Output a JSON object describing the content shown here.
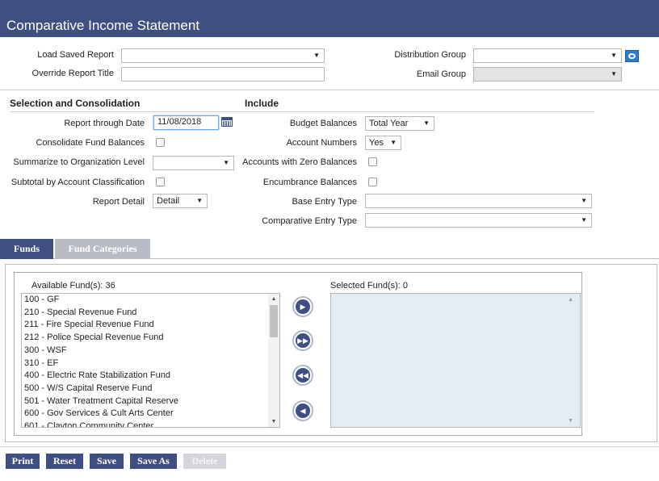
{
  "header": {
    "title": "Comparative Income Statement"
  },
  "top": {
    "load_saved_report_label": "Load Saved Report",
    "load_saved_report_value": "",
    "override_title_label": "Override Report Title",
    "override_title_value": "",
    "distribution_group_label": "Distribution Group",
    "distribution_group_value": "",
    "email_group_label": "Email Group",
    "email_group_value": ""
  },
  "selection": {
    "heading": "Selection and Consolidation",
    "report_through_date_label": "Report through Date",
    "report_through_date_value": "11/08/2018",
    "consolidate_fund_label": "Consolidate Fund Balances",
    "consolidate_fund_checked": false,
    "summarize_org_label": "Summarize to Organization Level",
    "summarize_org_value": "",
    "subtotal_label": "Subtotal by Account Classification",
    "subtotal_checked": false,
    "report_detail_label": "Report Detail",
    "report_detail_value": "Detail"
  },
  "include": {
    "heading": "Include",
    "budget_balances_label": "Budget Balances",
    "budget_balances_value": "Total Year",
    "account_numbers_label": "Account Numbers",
    "account_numbers_value": "Yes",
    "zero_balances_label": "Accounts with Zero Balances",
    "zero_balances_checked": false,
    "encumbrance_label": "Encumbrance Balances",
    "encumbrance_checked": false,
    "base_entry_label": "Base Entry Type",
    "base_entry_value": "",
    "comparative_entry_label": "Comparative Entry Type",
    "comparative_entry_value": ""
  },
  "tabs": [
    {
      "label": "Funds",
      "active": true
    },
    {
      "label": "Fund Categories",
      "active": false
    }
  ],
  "funds": {
    "available_label": "Available Fund(s): 36",
    "selected_label": "Selected Fund(s): 0",
    "available": [
      "100 - GF",
      "210 - Special Revenue Fund",
      "211 - Fire Special Revenue Fund",
      "212 - Police Special Revenue Fund",
      "300 - WSF",
      "310 - EF",
      "400 - Electric Rate Stabilization Fund",
      "500 - W/S Capital Reserve Fund",
      "501 - Water Treatment Capital Reserve",
      "600 - Gov Services & Cult Arts Center",
      "601 - Clayton Community Center"
    ],
    "selected": []
  },
  "move_buttons": [
    "move-one-right",
    "move-all-right",
    "move-all-left",
    "move-one-left"
  ],
  "buttons": {
    "print": "Print",
    "reset": "Reset",
    "save": "Save",
    "save_as": "Save As",
    "delete": "Delete"
  },
  "colors": {
    "header_bg": "#3f4f82",
    "selected_list_bg": "#e2ecf3",
    "inactive_tab": "#b9bcc6"
  }
}
